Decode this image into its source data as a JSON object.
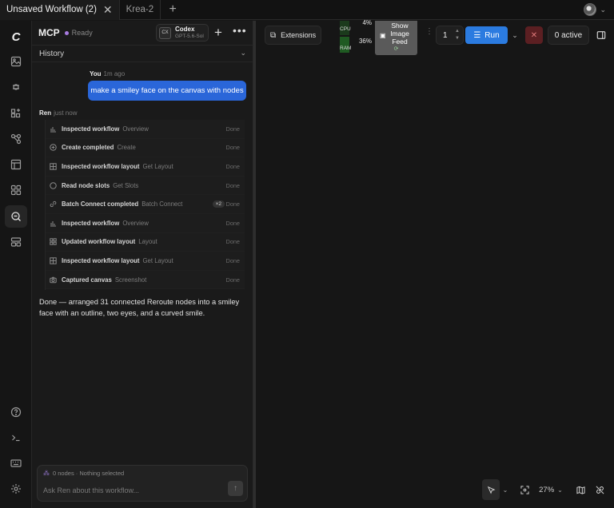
{
  "tabs": [
    {
      "label": "Unsaved Workflow (2)",
      "active": true
    },
    {
      "label": "Krea-2",
      "active": false
    }
  ],
  "tab_add_symbol": "+",
  "panel": {
    "title": "MCP",
    "status": "Ready",
    "model": {
      "icon_text": "CX",
      "name": "Codex",
      "version": "GPT-5.6-Sol"
    },
    "history_label": "History"
  },
  "conversation": {
    "user": {
      "author": "You",
      "time": "1m ago",
      "message": "make a smiley face on the canvas with nodes"
    },
    "assistant": {
      "author": "Ren",
      "time": "just now"
    },
    "steps": [
      {
        "name": "Inspected workflow",
        "tool": "Overview",
        "status": "Done",
        "icon": "chart-icon"
      },
      {
        "name": "Create completed",
        "tool": "Create",
        "status": "Done",
        "icon": "plus-circle-icon"
      },
      {
        "name": "Inspected workflow layout",
        "tool": "Get Layout",
        "status": "Done",
        "icon": "layout-icon"
      },
      {
        "name": "Read node slots",
        "tool": "Get Slots",
        "status": "Done",
        "icon": "circle-icon"
      },
      {
        "name": "Batch Connect completed",
        "tool": "Batch Connect",
        "status": "Done",
        "badge": "×2",
        "icon": "link-icon"
      },
      {
        "name": "Inspected workflow",
        "tool": "Overview",
        "status": "Done",
        "icon": "chart-icon"
      },
      {
        "name": "Updated workflow layout",
        "tool": "Layout",
        "status": "Done",
        "icon": "grid-icon"
      },
      {
        "name": "Inspected workflow layout",
        "tool": "Get Layout",
        "status": "Done",
        "icon": "layout-icon"
      },
      {
        "name": "Captured canvas",
        "tool": "Screenshot",
        "status": "Done",
        "icon": "camera-icon"
      }
    ],
    "final_message": "Done — arranged 31 connected Reroute nodes into a smiley face with an outline, two eyes, and a curved smile."
  },
  "composer": {
    "context": "0 nodes · Nothing selected",
    "placeholder": "Ask Ren about this workflow..."
  },
  "toolbar": {
    "extensions_label": "Extensions",
    "monitor": {
      "cpu_label": "CPU",
      "cpu_value": "4%",
      "cpu_level": 0.04,
      "ram_label": "RAM",
      "ram_value": "36%",
      "ram_level": 0.36
    },
    "image_feed_label": "Show Image Feed",
    "queue_count": "1",
    "run_label": "Run",
    "active_label": "0 active"
  },
  "canvas_controls": {
    "zoom_label": "27%"
  },
  "colors": {
    "accent_blue": "#2b7be0",
    "user_bubble": "#2a66d9",
    "stop_red": "#5b1f22",
    "status_purple": "#a77be0",
    "monitor_green": "#1f5a22"
  }
}
